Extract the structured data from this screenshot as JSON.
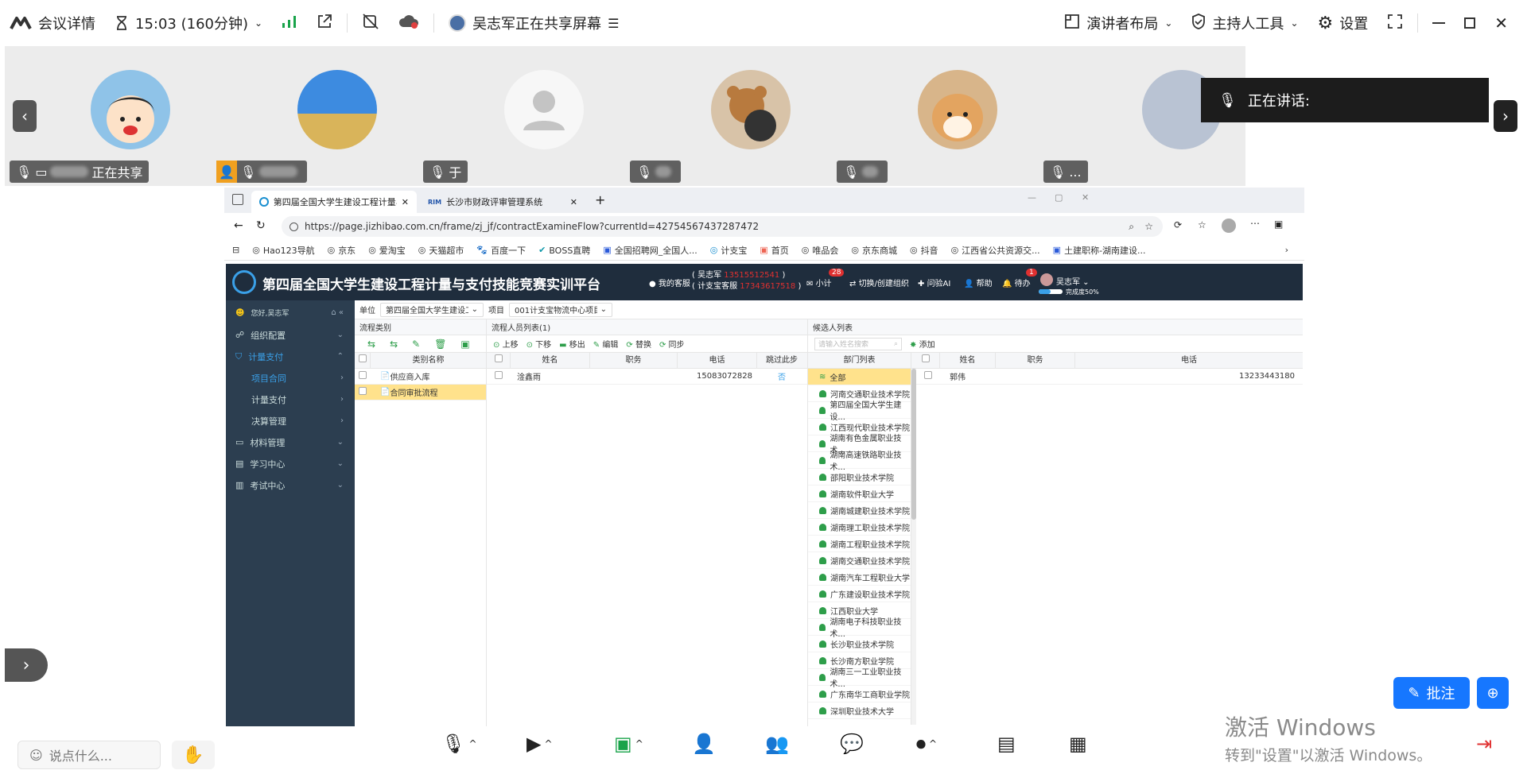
{
  "topbar": {
    "meeting_details": "会议详情",
    "timer": "15:03 (160分钟)",
    "sharing_status": "吴志军正在共享屏幕",
    "speaker_layout": "演讲者布局",
    "host_tools": "主持人工具",
    "settings": "设置"
  },
  "participants": [
    {
      "name": "正在共享"
    },
    {
      "name": ""
    },
    {
      "name": "于"
    },
    {
      "name": ""
    },
    {
      "name": ""
    },
    {
      "name": "..."
    }
  ],
  "speaking": {
    "label": "正在讲话:"
  },
  "browser": {
    "tabs": [
      {
        "title": "第四届全国大学生建设工程计量与"
      },
      {
        "title": "长沙市财政评审管理系统"
      }
    ],
    "url": "https://page.jizhibao.com.cn/frame/zj_jf/contractExamineFlow?currentId=427545674372874​72",
    "bookmarks": [
      "Hao123导航",
      "京东",
      "爱淘宝",
      "天猫超市",
      "百度一下",
      "BOSS直聘",
      "全国招聘网_全国人...",
      "计支宝",
      "首页",
      "唯品会",
      "京东商城",
      "抖音",
      "江西省公共资源交...",
      "土建职称-湖南建设..."
    ]
  },
  "app": {
    "title": "第四届全国大学生建设工程计量与支付技能竞赛实训平台",
    "service": "我的客服",
    "contact_name": "吴志军",
    "contact_phone": "13515512541",
    "contact_label2": "计支宝客服",
    "contact_phone2": "17343617518",
    "msg_label": "小计",
    "msg_badge": "28",
    "switch_org": "切换/创建组织",
    "ask_ai": "问验AI",
    "help": "帮助",
    "todo": "待办",
    "todo_badge": "1",
    "user": "吴志军",
    "progress_label": "完成度50%",
    "progress": 0.5
  },
  "sidebar": {
    "greeting": "您好,吴志军",
    "items": [
      {
        "label": "组织配置"
      },
      {
        "label": "计量支付"
      },
      {
        "label": "项目合同"
      },
      {
        "label": "计量支付"
      },
      {
        "label": "决算管理"
      },
      {
        "label": "材料管理"
      },
      {
        "label": "学习中心"
      },
      {
        "label": "考试中心"
      }
    ]
  },
  "filter": {
    "unit_label": "单位",
    "unit_value": "第四届全国大学生建设工",
    "project_label": "项目",
    "project_value": "001计支宝物流中心项目"
  },
  "flow": {
    "title": "流程类别",
    "col_name": "类别名称",
    "rows": [
      "供应商入库",
      "合同审批流程"
    ]
  },
  "members": {
    "title": "流程人员列表(1)",
    "tools": [
      "上移",
      "下移",
      "移出",
      "编辑",
      "替换",
      "同步"
    ],
    "cols": [
      "姓名",
      "职务",
      "电话",
      "跳过此步"
    ],
    "rows": [
      {
        "name": "淦鑫雨",
        "title": "",
        "phone": "15083072828",
        "skip": "否"
      }
    ]
  },
  "candidates": {
    "title": "候选人列表",
    "search_placeholder": "请输入姓名搜索",
    "add": "添加",
    "dept_col": "部门列表",
    "cols": [
      "姓名",
      "职务",
      "电话"
    ],
    "depts": [
      "全部",
      "河南交通职业技术学院",
      "第四届全国大学生建设...",
      "江西现代职业技术学院",
      "湖南有色金属职业技术...",
      "湖南高速铁路职业技术...",
      "邵阳职业技术学院",
      "湖南软件职业大学",
      "湖南城建职业技术学院",
      "湖南理工职业技术学院",
      "湖南工程职业技术学院",
      "湖南交通职业技术学院",
      "湖南汽车工程职业大学",
      "广东建设职业技术学院",
      "江西职业大学",
      "湖南电子科技职业技术...",
      "长沙职业技术学院",
      "长沙南方职业学院",
      "湖南三一工业职业技术...",
      "广东南华工商职业学院",
      "深圳职业技术大学"
    ],
    "rows": [
      {
        "name": "郭伟",
        "title": "",
        "phone": "13233443180"
      }
    ]
  },
  "bottom": {
    "chat_placeholder": "说点什么...",
    "annotate": "批注"
  },
  "watermark": {
    "line1": "激活 Windows",
    "line2": "转到\"设置\"以激活 Windows。"
  }
}
